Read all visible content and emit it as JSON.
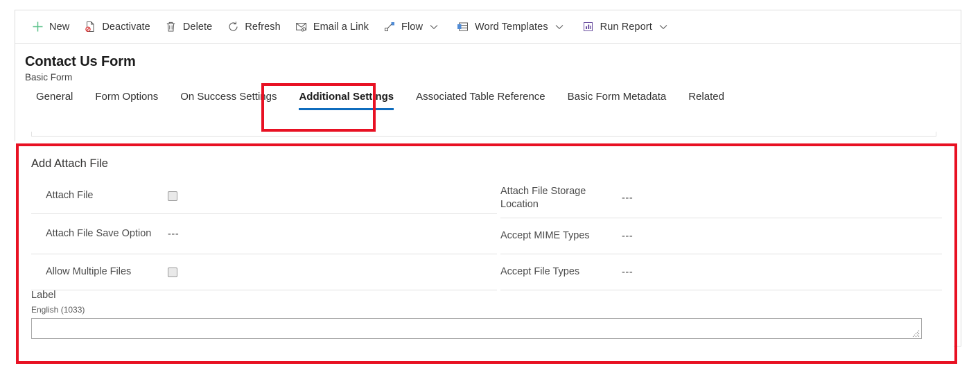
{
  "theme": {
    "accent": "#0f6cbd",
    "annotation": "#e81123",
    "text": "#333333",
    "muted": "#4a4a4a"
  },
  "command_bar": {
    "items": [
      {
        "label": "New",
        "icon": "plus-icon",
        "has_chevron": false
      },
      {
        "label": "Deactivate",
        "icon": "deactivate-icon",
        "has_chevron": false
      },
      {
        "label": "Delete",
        "icon": "trash-icon",
        "has_chevron": false
      },
      {
        "label": "Refresh",
        "icon": "refresh-icon",
        "has_chevron": false
      },
      {
        "label": "Email a Link",
        "icon": "email-link-icon",
        "has_chevron": false
      },
      {
        "label": "Flow",
        "icon": "flow-icon",
        "has_chevron": true
      },
      {
        "label": "Word Templates",
        "icon": "word-template-icon",
        "has_chevron": true
      },
      {
        "label": "Run Report",
        "icon": "run-report-icon",
        "has_chevron": true
      }
    ]
  },
  "record": {
    "title": "Contact Us Form",
    "subtitle": "Basic Form"
  },
  "tabs": [
    {
      "label": "General",
      "active": false
    },
    {
      "label": "Form Options",
      "active": false
    },
    {
      "label": "On Success Settings",
      "active": false
    },
    {
      "label": "Additional Settings",
      "active": true
    },
    {
      "label": "Associated Table Reference",
      "active": false
    },
    {
      "label": "Basic Form Metadata",
      "active": false
    },
    {
      "label": "Related",
      "active": false
    }
  ],
  "form": {
    "section_title": "Add Attach File",
    "left_fields": [
      {
        "label": "Attach File",
        "value": "",
        "control": "checkbox"
      },
      {
        "label": "Attach File Save Option",
        "value": "---",
        "control": "text"
      },
      {
        "label": "Allow Multiple Files",
        "value": "",
        "control": "checkbox"
      }
    ],
    "right_fields": [
      {
        "label": "Attach File Storage Location",
        "value": "---",
        "control": "text"
      },
      {
        "label": "Accept MIME Types",
        "value": "---",
        "control": "text"
      },
      {
        "label": "Accept File Types",
        "value": "---",
        "control": "text"
      }
    ],
    "label_block": {
      "title": "Label",
      "language": "English (1033)",
      "value": "",
      "placeholder": ""
    }
  },
  "annotations": [
    {
      "name": "additional-settings-highlight",
      "target": "Additional Settings"
    },
    {
      "name": "add-attach-file-section-highlight",
      "target": "Add Attach File"
    }
  ]
}
